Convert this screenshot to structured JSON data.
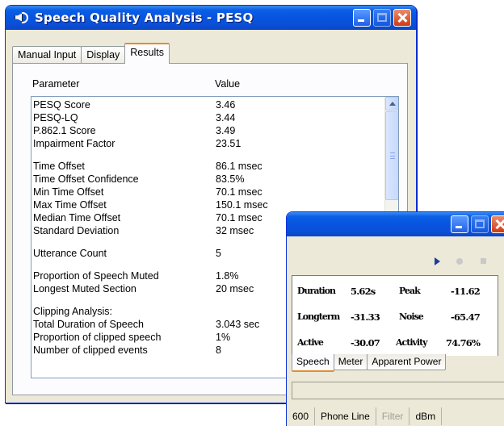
{
  "main_window": {
    "title": "Speech Quality Analysis - PESQ",
    "tabs": [
      {
        "label": "Manual Input",
        "active": false
      },
      {
        "label": "Display",
        "active": false
      },
      {
        "label": "Results",
        "active": true
      }
    ],
    "columns": {
      "parameter": "Parameter",
      "value": "Value"
    },
    "rows": [
      {
        "parameter": "PESQ Score",
        "value": "3.46"
      },
      {
        "parameter": "PESQ-LQ",
        "value": "3.44"
      },
      {
        "parameter": "P.862.1 Score",
        "value": "3.49"
      },
      {
        "parameter": "Impairment Factor",
        "value": "23.51"
      },
      {
        "parameter": "",
        "value": ""
      },
      {
        "parameter": "Time Offset",
        "value": "86.1 msec"
      },
      {
        "parameter": "Time Offset Confidence",
        "value": "83.5%"
      },
      {
        "parameter": "Min Time Offset",
        "value": "70.1 msec"
      },
      {
        "parameter": "Max Time Offset",
        "value": "150.1 msec"
      },
      {
        "parameter": "Median Time Offset",
        "value": "70.1 msec"
      },
      {
        "parameter": "Standard Deviation",
        "value": "32 msec"
      },
      {
        "parameter": "",
        "value": ""
      },
      {
        "parameter": "Utterance Count",
        "value": "5"
      },
      {
        "parameter": "",
        "value": ""
      },
      {
        "parameter": "Proportion of Speech Muted",
        "value": "1.8%"
      },
      {
        "parameter": "Longest Muted Section",
        "value": "20 msec"
      },
      {
        "parameter": "",
        "value": ""
      },
      {
        "parameter": "Clipping Analysis:",
        "value": ""
      },
      {
        "parameter": "Total Duration of Speech",
        "value": "3.043 sec"
      },
      {
        "parameter": "Proportion of clipped speech",
        "value": "1%"
      },
      {
        "parameter": "Number of clipped events",
        "value": "8"
      }
    ]
  },
  "meter_window": {
    "readings": [
      {
        "label": "Duration",
        "value": "5.62s"
      },
      {
        "label": "Peak",
        "value": "-11.62"
      },
      {
        "label": "Longterm",
        "value": "-31.33"
      },
      {
        "label": "Noise",
        "value": "-65.47"
      },
      {
        "label": "Active",
        "value": "-30.07"
      },
      {
        "label": "Activity",
        "value": "74.76%"
      }
    ],
    "tabs": [
      {
        "label": "Speech",
        "active": true
      },
      {
        "label": "Meter",
        "active": false
      },
      {
        "label": "Apparent Power",
        "active": false
      }
    ],
    "statusbar": [
      "600",
      "Phone Line",
      "Filter",
      "dBm"
    ]
  },
  "colors": {
    "titlebar": "#0854e0",
    "close_button": "#cf3b16",
    "window_face": "#ece9d8",
    "active_tab_accent": "#e68b2c"
  }
}
